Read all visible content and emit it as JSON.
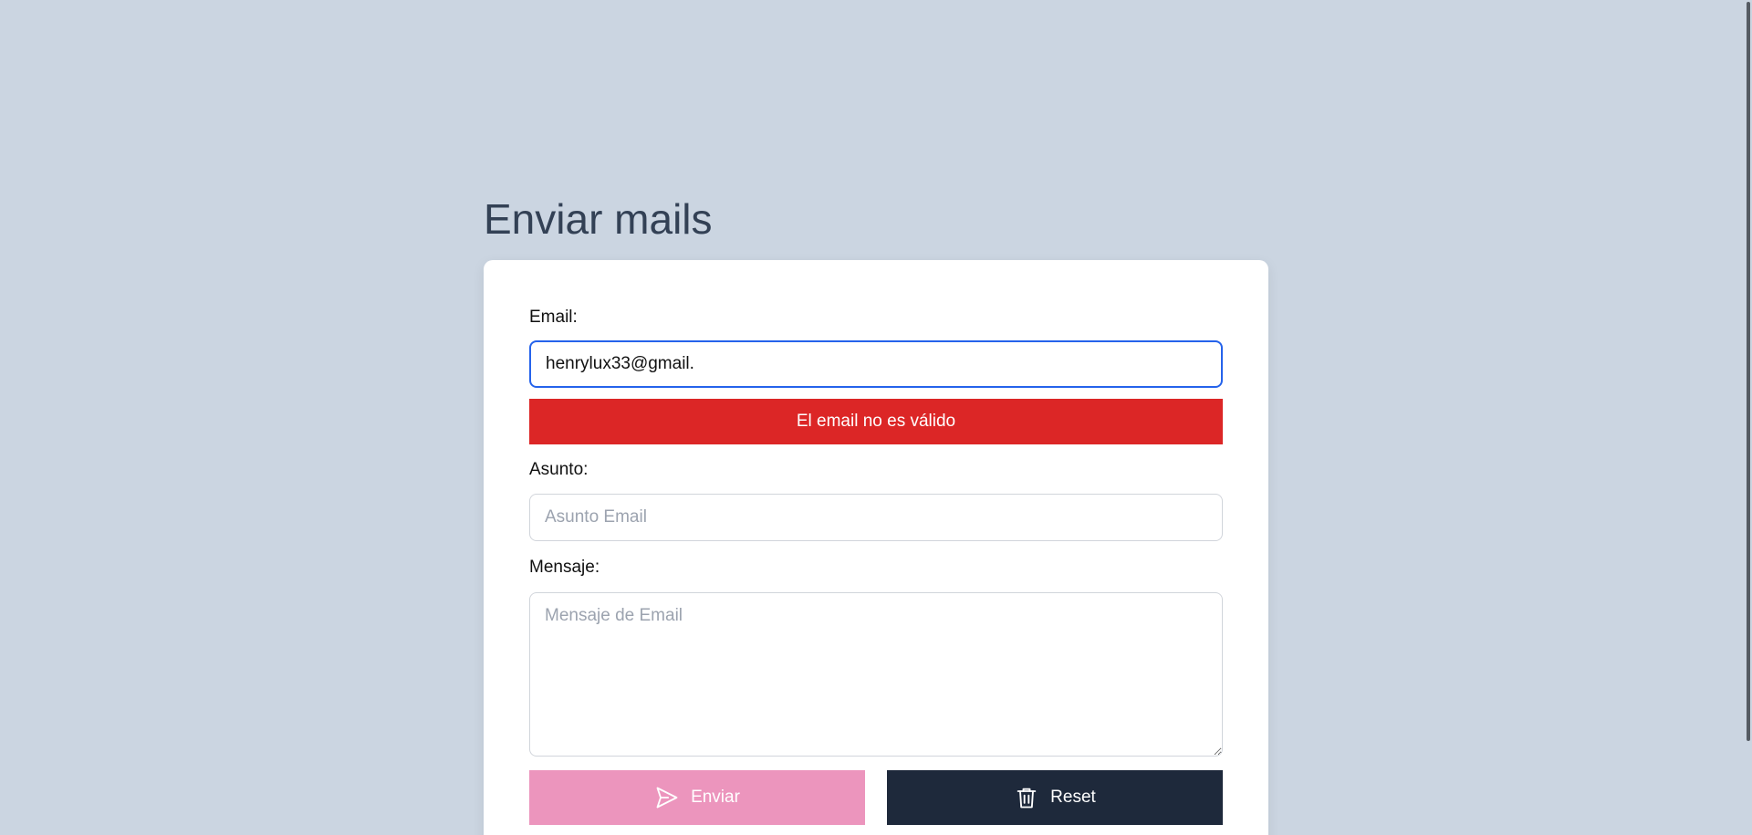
{
  "page": {
    "title": "Enviar mails"
  },
  "form": {
    "email": {
      "label": "Email:",
      "value": "henrylux33@gmail."
    },
    "error_message": "El email no es válido",
    "subject": {
      "label": "Asunto:",
      "placeholder": "Asunto Email",
      "value": ""
    },
    "message": {
      "label": "Mensaje:",
      "placeholder": "Mensaje de Email",
      "value": ""
    },
    "buttons": {
      "send_label": "Enviar",
      "send_icon": "paper-plane-icon",
      "reset_label": "Reset",
      "reset_icon": "trash-icon"
    }
  },
  "colors": {
    "background": "#cbd5e1",
    "card": "#ffffff",
    "error": "#dc2626",
    "send_button": "#ec95bd",
    "reset_button": "#1e293b",
    "focus_border": "#2563eb",
    "title": "#334155"
  }
}
